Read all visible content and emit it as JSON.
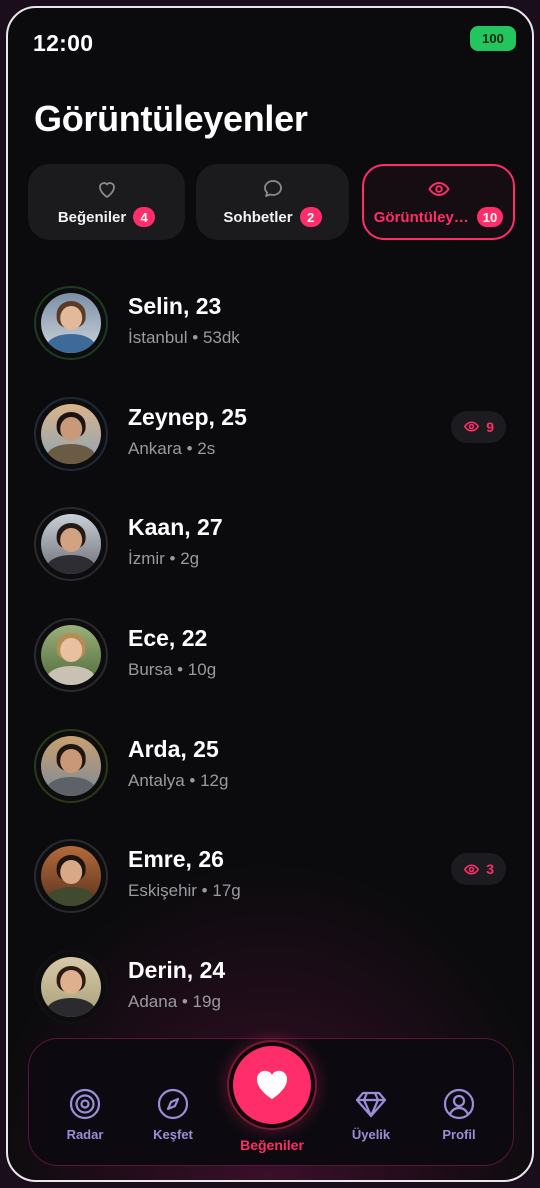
{
  "status": {
    "time": "12:00",
    "battery": "100"
  },
  "title": "Görüntüleyenler",
  "tabs": [
    {
      "label": "Beğeniler",
      "count": "4",
      "icon": "heart-outline-icon",
      "active": false
    },
    {
      "label": "Sohbetler",
      "count": "2",
      "icon": "chat-bubble-icon",
      "active": false
    },
    {
      "label": "Görüntüleyenler",
      "count": "10",
      "icon": "eye-icon",
      "active": true
    }
  ],
  "people": [
    {
      "name": "Selin, 23",
      "meta": "İstanbul • 53dk",
      "views": null
    },
    {
      "name": "Zeynep, 25",
      "meta": "Ankara • 2s",
      "views": "9"
    },
    {
      "name": "Kaan, 27",
      "meta": "İzmir • 2g",
      "views": null
    },
    {
      "name": "Ece, 22",
      "meta": "Bursa • 10g",
      "views": null
    },
    {
      "name": "Arda, 25",
      "meta": "Antalya • 12g",
      "views": null
    },
    {
      "name": "Emre, 26",
      "meta": "Eskişehir • 17g",
      "views": "3"
    },
    {
      "name": "Derin, 24",
      "meta": "Adana • 19g",
      "views": null
    }
  ],
  "nav": {
    "items": [
      {
        "label": "Radar",
        "icon": "radar-icon"
      },
      {
        "label": "Keşfet",
        "icon": "compass-icon"
      },
      {
        "label": "Beğeniler",
        "icon": "heart-icon"
      },
      {
        "label": "Üyelik",
        "icon": "diamond-icon"
      },
      {
        "label": "Profil",
        "icon": "user-circle-icon"
      }
    ]
  },
  "colors": {
    "accent": "#ff2d6a",
    "battery": "#22c55e",
    "nav_muted": "#9a8ed6"
  }
}
